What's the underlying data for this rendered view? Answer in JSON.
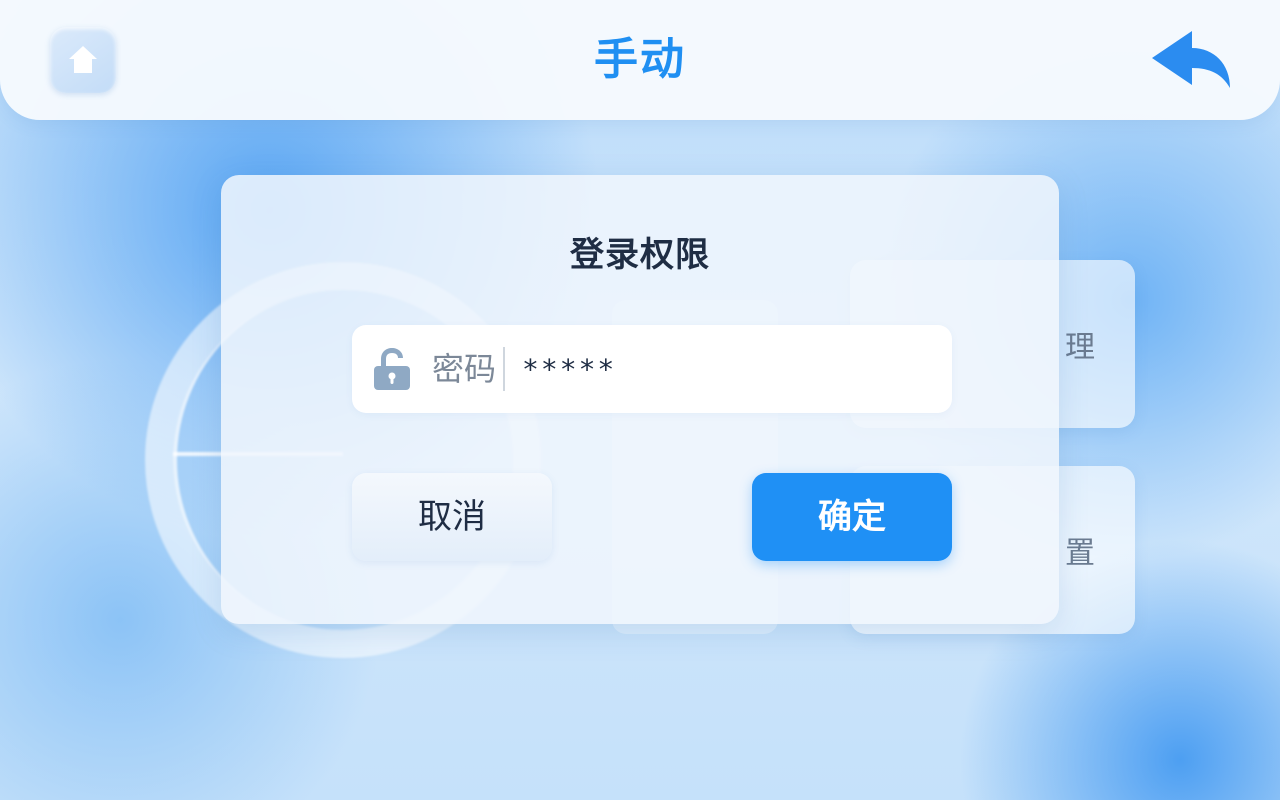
{
  "header": {
    "title": "手动",
    "home_icon": "home-icon",
    "back_icon": "back-arrow-icon"
  },
  "background": {
    "card_top_right_label": "理",
    "card_bottom_right_label": "置"
  },
  "dialog": {
    "title": "登录权限",
    "password": {
      "icon": "unlock-icon",
      "label": "密码",
      "value": "*****"
    },
    "cancel_label": "取消",
    "confirm_label": "确定"
  },
  "colors": {
    "accent": "#1F90F5",
    "title_text": "#1F2D44",
    "background": "#CFE6FB"
  }
}
